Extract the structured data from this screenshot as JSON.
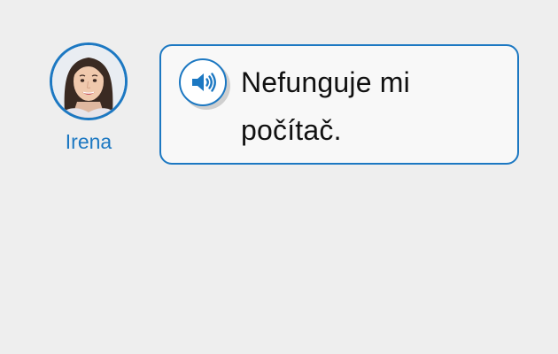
{
  "speaker": {
    "name": "Irena",
    "avatar_icon": "portrait-avatar"
  },
  "message": {
    "text": "Nefunguje mi počítač.",
    "audio_icon": "speaker-volume-icon"
  },
  "colors": {
    "accent": "#1c78c2",
    "background": "#eeeeee",
    "bubble": "#f8f8f8",
    "text": "#111111"
  }
}
